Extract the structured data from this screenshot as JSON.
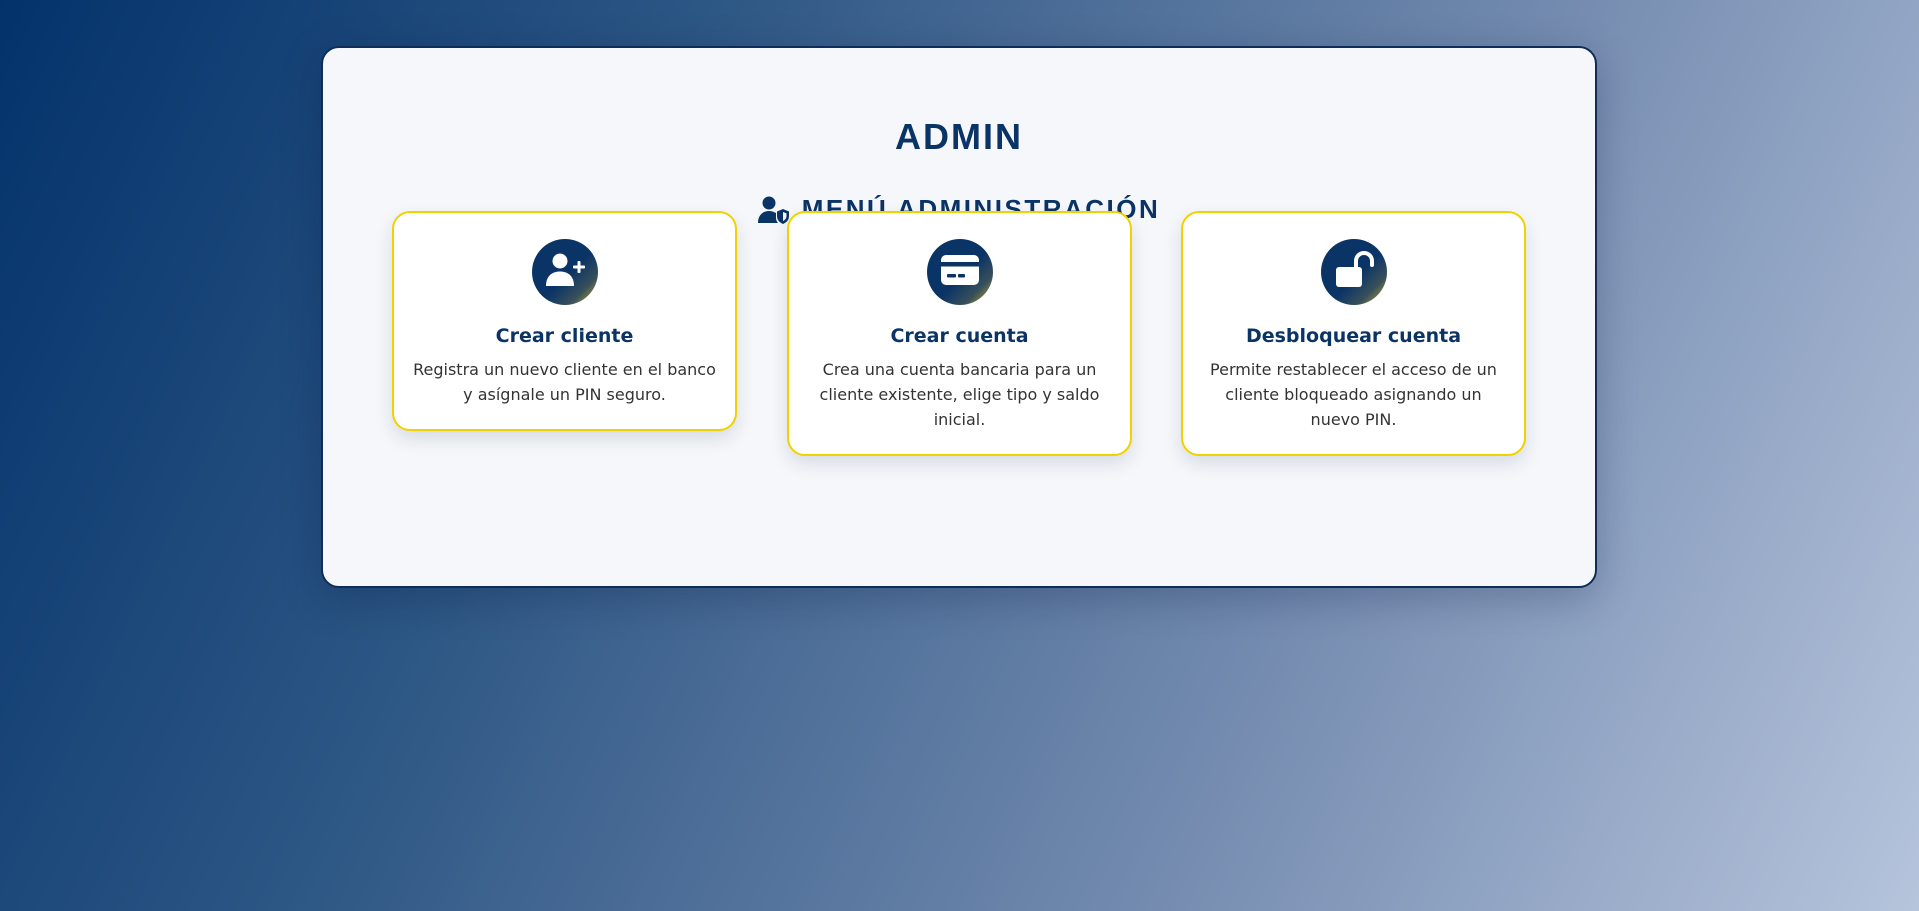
{
  "page": {
    "title": "ADMIN",
    "subtitle": "MENÚ ADMINISTRACIÓN",
    "subtitle_icon": "user-shield-icon"
  },
  "colors": {
    "primary": "#0b3466",
    "accent": "#f2d100",
    "panel_bg": "#f5f7fa"
  },
  "cards": [
    {
      "icon": "user-plus-icon",
      "title": "Crear cliente",
      "description": "Registra un nuevo cliente en el banco y asígnale un PIN seguro."
    },
    {
      "icon": "credit-card-icon",
      "title": "Crear cuenta",
      "description": "Crea una cuenta bancaria para un cliente existente, elige tipo y saldo inicial."
    },
    {
      "icon": "unlock-icon",
      "title": "Desbloquear cuenta",
      "description": "Permite restablecer el acceso de un cliente bloqueado asignando un nuevo PIN."
    }
  ]
}
